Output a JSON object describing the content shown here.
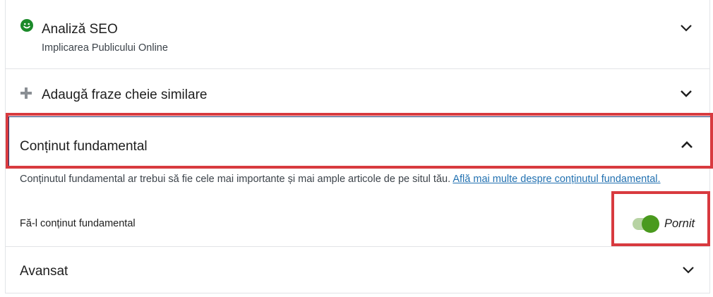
{
  "sections": {
    "seo": {
      "title": "Analiză SEO",
      "subtitle": "Implicarea Publicului Online",
      "icon": "smiley-icon",
      "status_color": "#1b8a2a"
    },
    "related_keyphrases": {
      "title": "Adaugă fraze cheie similare",
      "icon": "plus-icon"
    },
    "cornerstone": {
      "title": "Conținut fundamental",
      "description": "Conținutul fundamental ar trebui să fie cele mai importante și mai ample articole de pe situl tău.",
      "link_text": "Află mai multe despre conținutul fundamental.",
      "toggle_label": "Fă-l conținut fundamental",
      "toggle_state": "Pornit",
      "toggle_on": true
    },
    "advanced": {
      "title": "Avansat"
    }
  },
  "colors": {
    "highlight": "#d83a3f",
    "toggle_on": "#4a9a1e",
    "link": "#2271b1"
  }
}
